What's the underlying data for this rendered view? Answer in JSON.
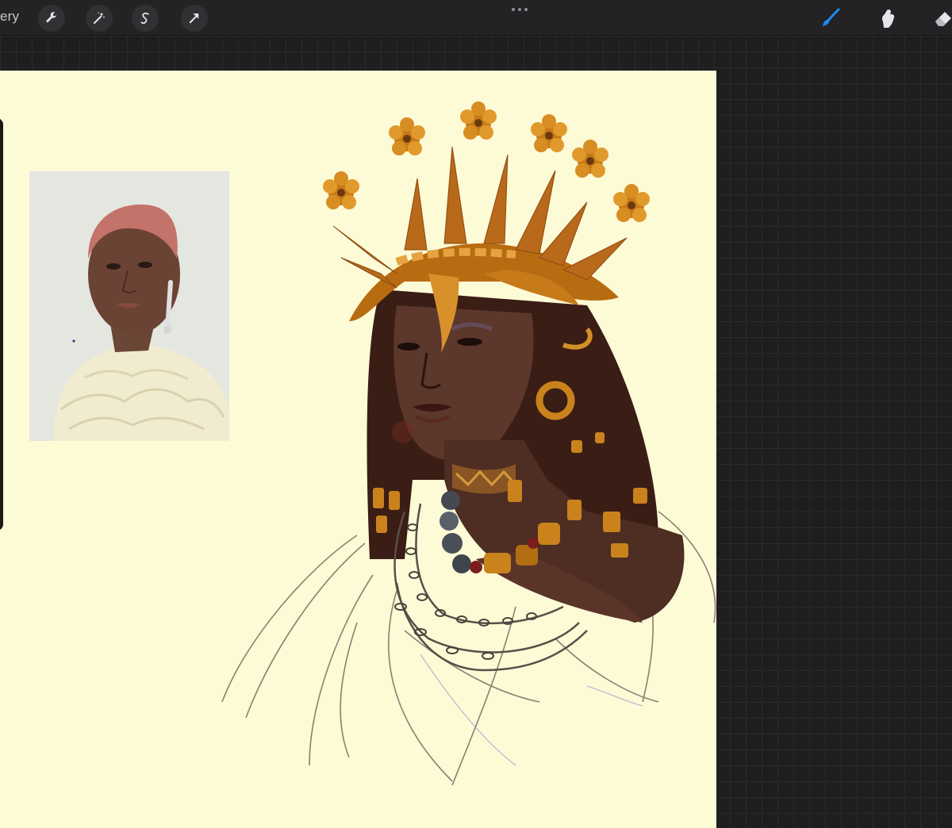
{
  "toolbar": {
    "gallery_label": "ery",
    "left_tools": [
      {
        "name": "actions",
        "icon": "wrench-icon"
      },
      {
        "name": "adjustments",
        "icon": "magic-wand-icon"
      },
      {
        "name": "selection",
        "icon": "selection-s-icon"
      },
      {
        "name": "transform",
        "icon": "arrow-cursor-icon"
      }
    ],
    "more_icon": "ellipsis-icon",
    "right_tools": [
      {
        "name": "brush",
        "icon": "brush-icon",
        "active": true
      },
      {
        "name": "smudge",
        "icon": "smudge-finger-icon",
        "active": false
      },
      {
        "name": "eraser",
        "icon": "eraser-icon",
        "active": false
      }
    ]
  },
  "colors": {
    "toolbar_bg": "#232325",
    "canvas_bg": "#fdfad6",
    "active_tool": "#1a8cff",
    "skin": "#5c362c",
    "gold": "#c9821c"
  },
  "canvas": {
    "reference_image": "reference-portrait",
    "artwork": "crowned-portrait-painting"
  }
}
